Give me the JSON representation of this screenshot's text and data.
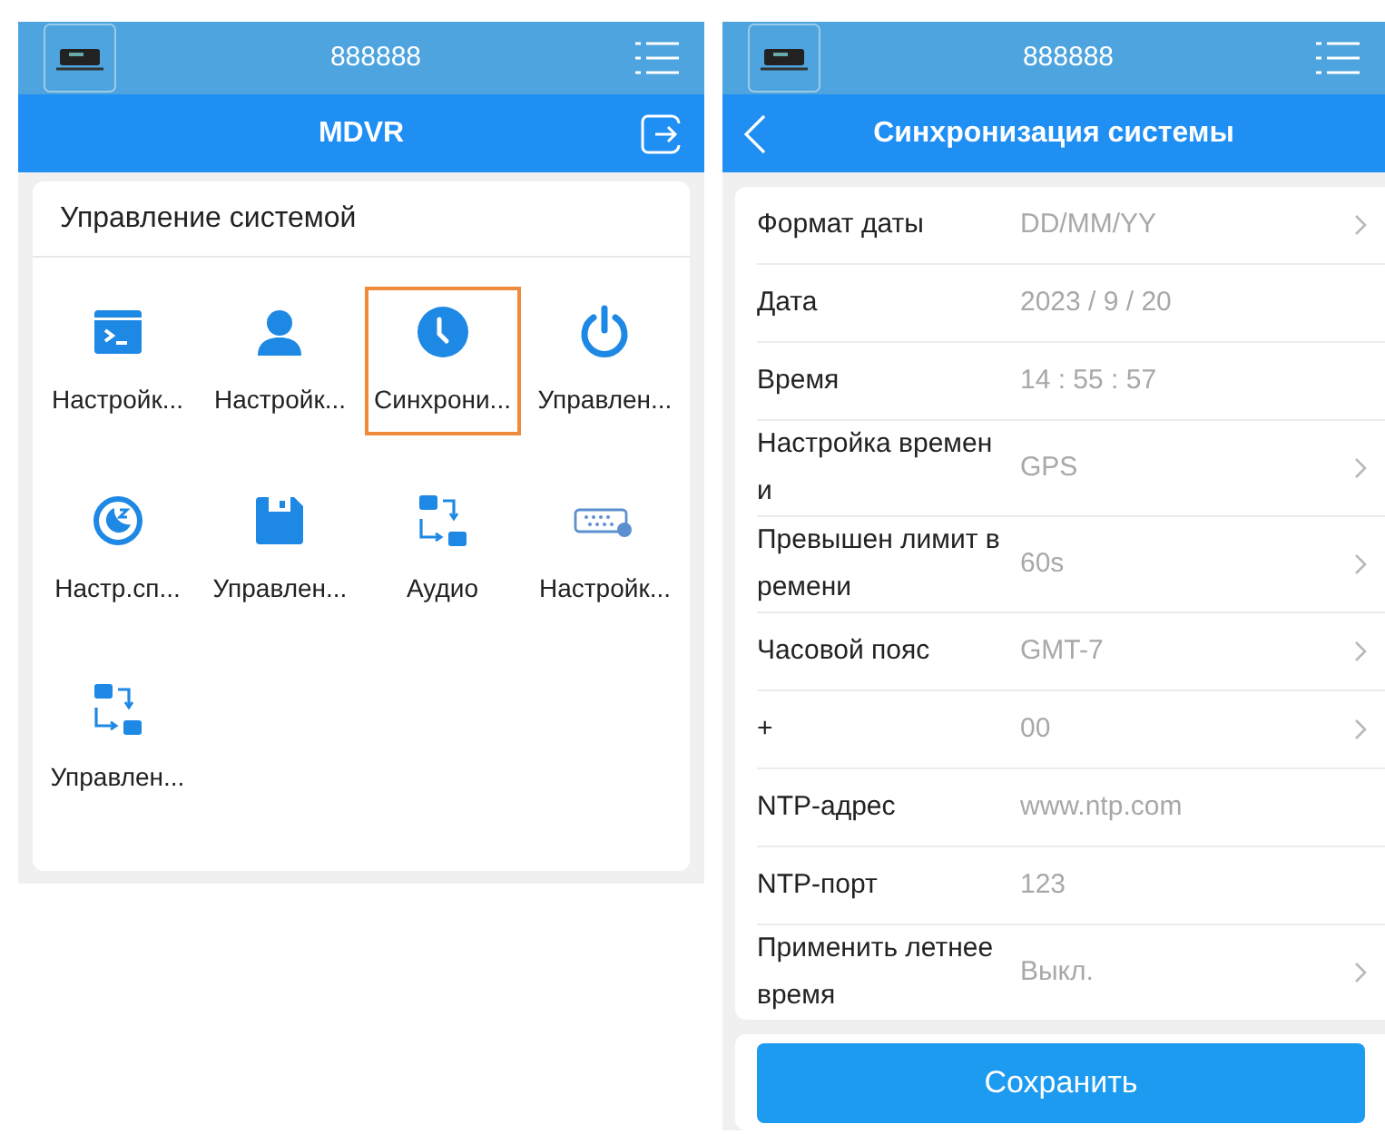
{
  "left_screen": {
    "device_name": "888888",
    "title": "MDVR",
    "section_title": "Управление системой",
    "items": [
      {
        "label": "Настройк...",
        "kind": "terminal",
        "selected": false
      },
      {
        "label": "Настройк...",
        "kind": "user",
        "selected": false
      },
      {
        "label": "Синхрони...",
        "kind": "clock",
        "selected": true
      },
      {
        "label": "Управлен...",
        "kind": "power",
        "selected": false
      },
      {
        "label": "Настр.сп...",
        "kind": "sleep",
        "selected": false
      },
      {
        "label": "Управлен...",
        "kind": "disk",
        "selected": false
      },
      {
        "label": "Аудио",
        "kind": "transfer",
        "selected": false
      },
      {
        "label": "Настройк...",
        "kind": "port",
        "selected": false
      },
      {
        "label": "Управлен...",
        "kind": "transfer",
        "selected": false
      }
    ]
  },
  "right_screen": {
    "device_name": "888888",
    "title": "Синхронизация системы",
    "rows": [
      {
        "label": "Формат даты",
        "value": "DD/MM/YY",
        "chevron": true
      },
      {
        "label": "Дата",
        "value": "2023 / 9 / 20",
        "chevron": false
      },
      {
        "label": "Время",
        "value": "14 : 55 : 57",
        "chevron": false
      },
      {
        "label": "Настройка времени",
        "value": "GPS",
        "chevron": true
      },
      {
        "label": "Превышен лимит времени",
        "value": "60s",
        "chevron": true
      },
      {
        "label": "Часовой пояс",
        "value": "GMT-7",
        "chevron": true
      },
      {
        "label": "+",
        "value": "00",
        "chevron": true
      },
      {
        "label": "NTP-адрес",
        "value": "www.ntp.com",
        "chevron": false
      },
      {
        "label": "NTP-порт",
        "value": "123",
        "chevron": false
      },
      {
        "label": "Применить летнее время",
        "value": "Выкл.",
        "chevron": true
      }
    ],
    "save_button": "Сохранить"
  }
}
